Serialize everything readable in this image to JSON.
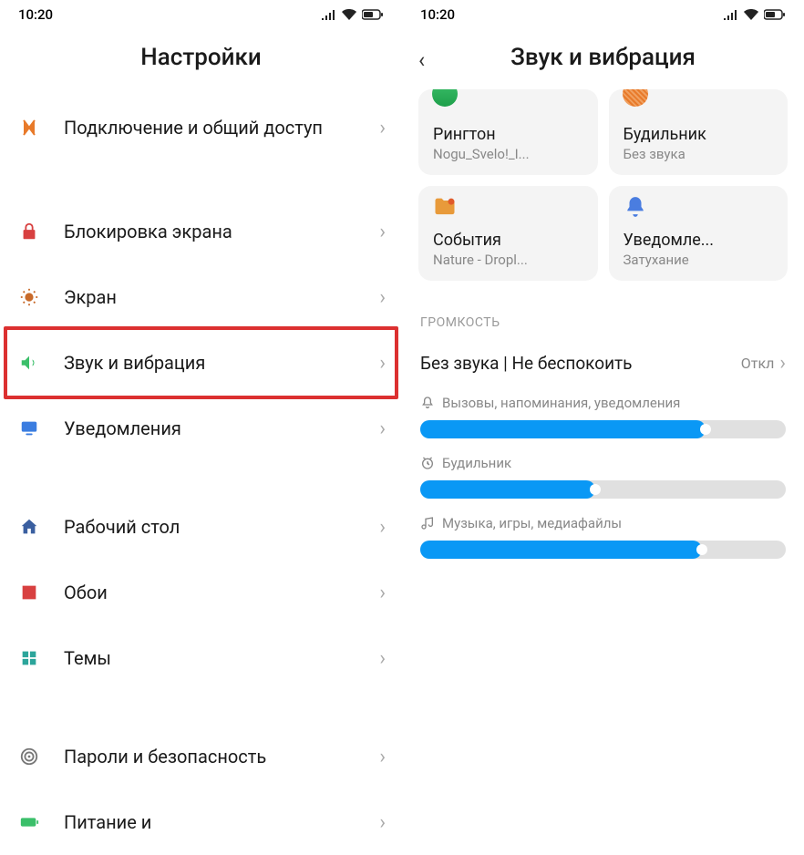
{
  "statusbar": {
    "time": "10:20"
  },
  "left": {
    "title": "Настройки",
    "items": {
      "connection": "Подключение и общий доступ",
      "lockscreen": "Блокировка экрана",
      "display": "Экран",
      "sound": "Звук и вибрация",
      "notifications": "Уведомления",
      "home": "Рабочий стол",
      "wallpaper": "Обои",
      "themes": "Темы",
      "security": "Пароли и безопасность",
      "battery": "Питание и"
    }
  },
  "right": {
    "title": "Звук и вибрация",
    "tiles": {
      "ringtone": {
        "title": "Рингтон",
        "sub": "Nogu_Svelo!_I..."
      },
      "alarm": {
        "title": "Будильник",
        "sub": "Без звука"
      },
      "events": {
        "title": "События",
        "sub": "Nature - Dropl..."
      },
      "notif": {
        "title": "Уведомле...",
        "sub": "Затухание"
      }
    },
    "section_volume": "ГРОМКОСТЬ",
    "dnd": {
      "label": "Без звука | Не беспокоить",
      "value": "Откл"
    },
    "sliders": {
      "calls": {
        "label": "Вызовы, напоминания, уведомления",
        "percent": 78
      },
      "alarm": {
        "label": "Будильник",
        "percent": 48
      },
      "media": {
        "label": "Музыка, игры, медиафайлы",
        "percent": 77
      }
    }
  }
}
